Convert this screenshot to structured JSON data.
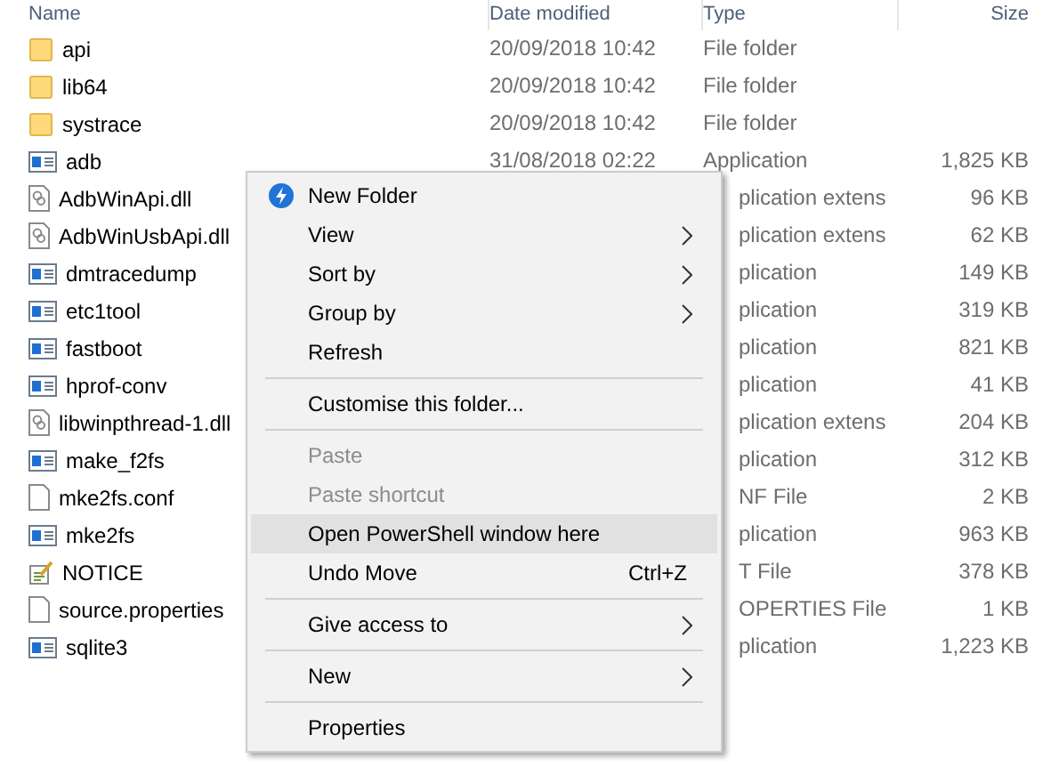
{
  "columns": [
    "Name",
    "Date modified",
    "Type",
    "Size"
  ],
  "rows": [
    {
      "name": "api",
      "kind": "folder",
      "date": "20/09/2018 10:42",
      "type": "File folder",
      "obscured": false
    },
    {
      "name": "lib64",
      "kind": "folder",
      "date": "20/09/2018 10:42",
      "type": "File folder",
      "obscured": false
    },
    {
      "name": "systrace",
      "kind": "folder",
      "date": "20/09/2018 10:42",
      "type": "File folder",
      "obscured": false
    },
    {
      "name": "adb",
      "kind": "app",
      "date": "31/08/2018 02:22",
      "type": "Application",
      "size": "1,825 KB",
      "obscured": false
    },
    {
      "name": "AdbWinApi.dll",
      "kind": "dll",
      "type": "plication extens",
      "size": "96 KB",
      "obscured": true
    },
    {
      "name": "AdbWinUsbApi.dll",
      "kind": "dll",
      "type": "plication extens",
      "size": "62 KB",
      "obscured": true
    },
    {
      "name": "dmtracedump",
      "kind": "app",
      "type": "plication",
      "size": "149 KB",
      "obscured": true
    },
    {
      "name": "etc1tool",
      "kind": "app",
      "type": "plication",
      "size": "319 KB",
      "obscured": true
    },
    {
      "name": "fastboot",
      "kind": "app",
      "type": "plication",
      "size": "821 KB",
      "obscured": true
    },
    {
      "name": "hprof-conv",
      "kind": "app",
      "type": "plication",
      "size": "41 KB",
      "obscured": true
    },
    {
      "name": "libwinpthread-1.dll",
      "kind": "dll",
      "type": "plication extens",
      "size": "204 KB",
      "obscured": true
    },
    {
      "name": "make_f2fs",
      "kind": "app",
      "type": "plication",
      "size": "312 KB",
      "obscured": true
    },
    {
      "name": "mke2fs.conf",
      "kind": "file",
      "type": "NF File",
      "size": "2 KB",
      "obscured": true
    },
    {
      "name": "mke2fs",
      "kind": "app",
      "type": "plication",
      "size": "963 KB",
      "obscured": true
    },
    {
      "name": "NOTICE",
      "kind": "text",
      "type": "T File",
      "size": "378 KB",
      "obscured": true
    },
    {
      "name": "source.properties",
      "kind": "file",
      "type": "OPERTIES File",
      "size": "1 KB",
      "obscured": true
    },
    {
      "name": "sqlite3",
      "kind": "app",
      "type": "plication",
      "size": "1,223 KB",
      "obscured": true
    }
  ],
  "context_menu": {
    "groups": [
      [
        {
          "label": "New Folder",
          "kind": "with-icon",
          "disabled": false,
          "selected": false
        },
        {
          "label": "View",
          "kind": "submenu",
          "disabled": false,
          "selected": false
        },
        {
          "label": "Sort by",
          "kind": "submenu",
          "disabled": false,
          "selected": false
        },
        {
          "label": "Group by",
          "kind": "submenu",
          "disabled": false,
          "selected": false
        },
        {
          "label": "Refresh",
          "kind": "plain",
          "disabled": false,
          "selected": false
        }
      ],
      [
        {
          "label": "Customise this folder...",
          "kind": "plain",
          "disabled": false,
          "selected": false
        }
      ],
      [
        {
          "label": "Paste",
          "kind": "plain",
          "disabled": true,
          "selected": false
        },
        {
          "label": "Paste shortcut",
          "kind": "plain",
          "disabled": true,
          "selected": false
        },
        {
          "label": "Open PowerShell window here",
          "kind": "plain",
          "disabled": false,
          "selected": true
        },
        {
          "label": "Undo Move",
          "kind": "plain",
          "disabled": false,
          "selected": false,
          "shortcut": "Ctrl+Z"
        }
      ],
      [
        {
          "label": "Give access to",
          "kind": "submenu",
          "disabled": false,
          "selected": false
        }
      ],
      [
        {
          "label": "New",
          "kind": "submenu",
          "disabled": false,
          "selected": false
        }
      ],
      [
        {
          "label": "Properties",
          "kind": "plain",
          "disabled": false,
          "selected": false
        }
      ]
    ]
  }
}
